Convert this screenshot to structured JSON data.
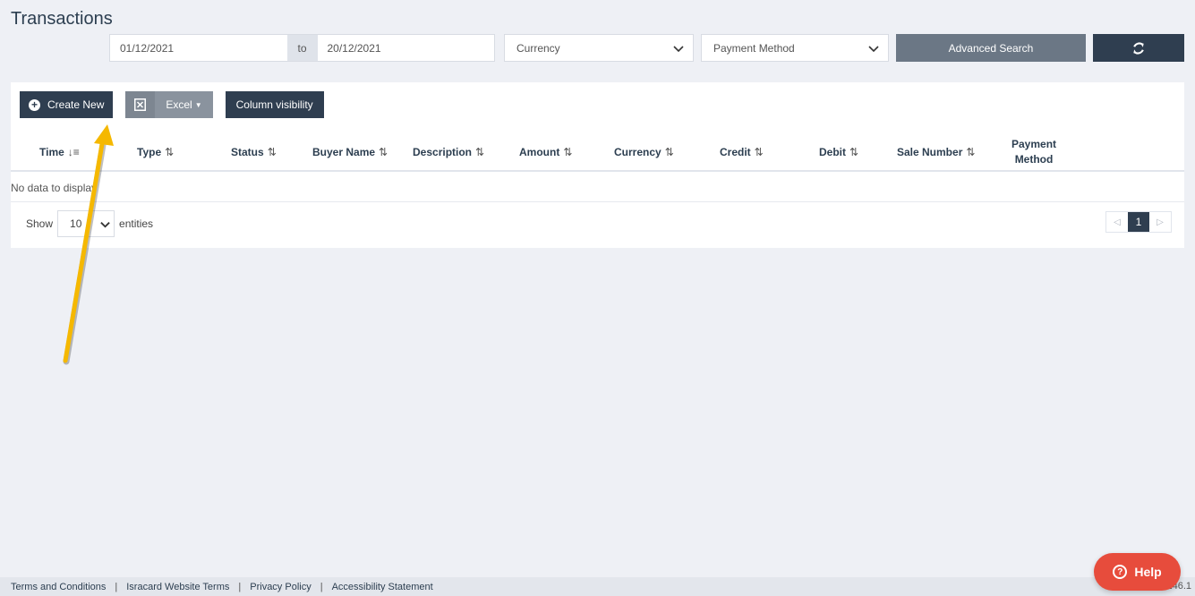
{
  "page": {
    "title": "Transactions"
  },
  "filters": {
    "date_from": "01/12/2021",
    "date_to_label": "to",
    "date_to": "20/12/2021",
    "currency_placeholder": "Currency",
    "payment_method_placeholder": "Payment Method",
    "advanced_search_label": "Advanced Search",
    "refresh_icon": "refresh-icon"
  },
  "toolbar": {
    "create_label": "Create New",
    "excel_label": "Excel",
    "column_visibility_label": "Column visibility"
  },
  "table": {
    "columns": [
      "Time",
      "Type",
      "Status",
      "Buyer Name",
      "Description",
      "Amount",
      "Currency",
      "Credit",
      "Debit",
      "Sale Number"
    ],
    "payment_method_col": [
      "Payment",
      "Method"
    ],
    "empty_message": "No data to display"
  },
  "pagination": {
    "show_label": "Show",
    "page_size": "10",
    "entities_label": "entities",
    "current_page": "1"
  },
  "footer": {
    "links": [
      "Terms and Conditions",
      "Isracard Website Terms",
      "Privacy Policy",
      "Accessibility Statement"
    ],
    "separator": "|",
    "version": "2.146.1"
  },
  "help": {
    "label": "Help"
  },
  "colors": {
    "dark_button": "#2f3e50",
    "gray_button": "#6b7785",
    "help_button": "#e74c3c",
    "annotation_arrow": "#f5b800"
  }
}
